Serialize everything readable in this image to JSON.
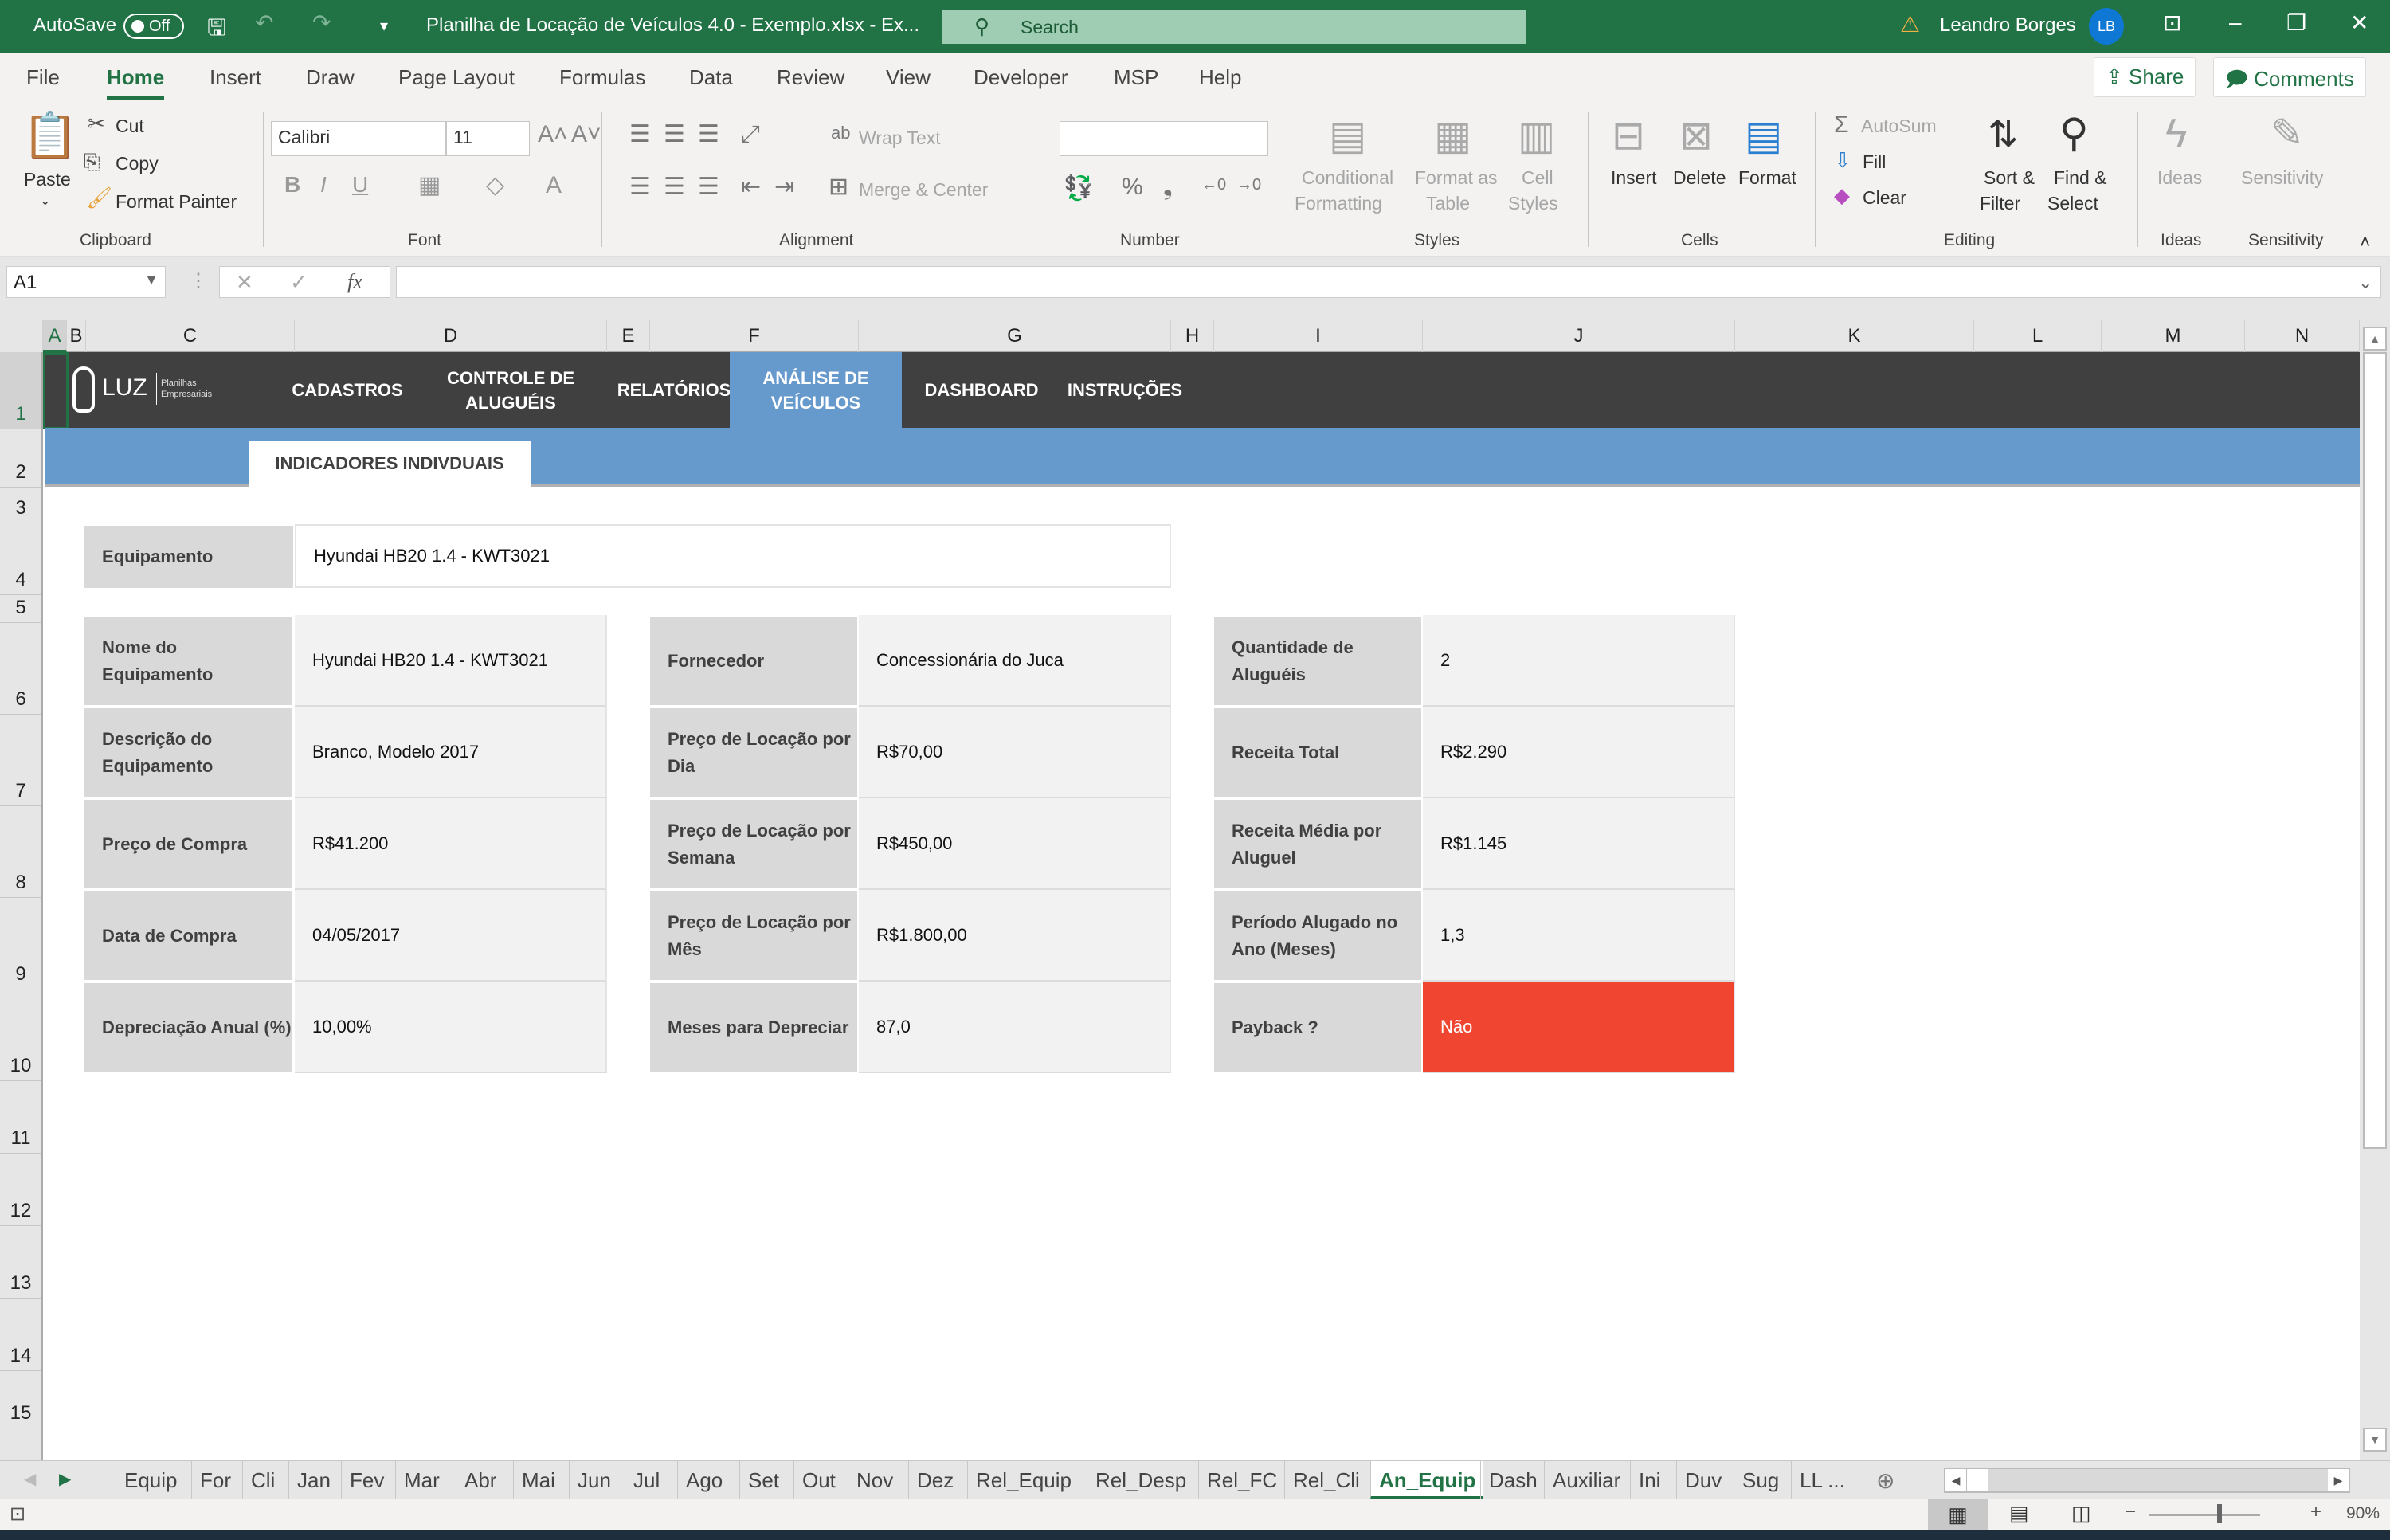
{
  "titlebar": {
    "autosave_label": "AutoSave",
    "autosave_state": "Off",
    "doc_title": "Planilha de Locação de Veículos 4.0 - Exemplo.xlsx  -  Ex...",
    "search_placeholder": "Search",
    "user_name": "Leandro Borges",
    "user_initials": "LB",
    "warning_icon": "warning-icon"
  },
  "ribbon_tabs": [
    "File",
    "Home",
    "Insert",
    "Draw",
    "Page Layout",
    "Formulas",
    "Data",
    "Review",
    "View",
    "Developer",
    "MSP",
    "Help"
  ],
  "active_tab": "Home",
  "share_label": "Share",
  "comments_label": "Comments",
  "ribbon": {
    "clipboard": {
      "paste": "Paste",
      "cut": "Cut",
      "copy": "Copy",
      "format_painter": "Format Painter",
      "group": "Clipboard"
    },
    "font": {
      "font_name": "Calibri",
      "font_size": "11",
      "group": "Font"
    },
    "alignment": {
      "wrap_text": "Wrap Text",
      "merge_center": "Merge & Center",
      "group": "Alignment"
    },
    "number": {
      "format": "",
      "group": "Number"
    },
    "styles": {
      "conditional": "Conditional",
      "conditional2": "Formatting",
      "format_as": "Format as",
      "format_as2": "Table",
      "cell": "Cell",
      "cell2": "Styles",
      "group": "Styles"
    },
    "cells": {
      "insert": "Insert",
      "delete": "Delete",
      "format": "Format",
      "group": "Cells"
    },
    "editing": {
      "autosum": "AutoSum",
      "fill": "Fill",
      "clear": "Clear",
      "sort": "Sort &",
      "sort2": "Filter",
      "find": "Find &",
      "find2": "Select",
      "group": "Editing"
    },
    "ideas": {
      "ideas": "Ideas",
      "group": "Ideas"
    },
    "sensitivity": {
      "sensitivity": "Sensitivity",
      "group": "Sensitivity"
    }
  },
  "formula_bar": {
    "name_box": "A1",
    "formula": ""
  },
  "columns": [
    "A",
    "B",
    "C",
    "D",
    "E",
    "F",
    "G",
    "H",
    "I",
    "J",
    "K",
    "L",
    "M",
    "N"
  ],
  "rows": [
    "1",
    "2",
    "3",
    "4",
    "5",
    "6",
    "7",
    "8",
    "9",
    "10",
    "11",
    "12",
    "13",
    "14",
    "15"
  ],
  "sheet": {
    "logo_text": "LUZ",
    "logo_sub1": "Planilhas",
    "logo_sub2": "Empresariais",
    "nav": [
      "CADASTROS",
      "CONTROLE DE ALUGUÉIS",
      "RELATÓRIOS",
      "ANÁLISE DE VEÍCULOS",
      "DASHBOARD",
      "INSTRUÇÕES"
    ],
    "nav_active": "ANÁLISE DE VEÍCULOS",
    "subtab": "INDICADORES INDIVDUAIS",
    "equip_label": "Equipamento",
    "equip_value": "Hyundai HB20 1.4 - KWT3021",
    "block1": [
      {
        "label": "Nome do Equipamento",
        "value": "Hyundai HB20 1.4 - KWT3021"
      },
      {
        "label": "Descrição do Equipamento",
        "value": "Branco, Modelo 2017"
      },
      {
        "label": "Preço de Compra",
        "value": "R$41.200"
      },
      {
        "label": "Data de Compra",
        "value": "04/05/2017"
      },
      {
        "label": "Depreciação Anual (%)",
        "value": "10,00%"
      }
    ],
    "block2": [
      {
        "label": "Fornecedor",
        "value": "Concessionária do Juca"
      },
      {
        "label": "Preço de Locação por Dia",
        "value": "R$70,00"
      },
      {
        "label": "Preço de Locação por Semana",
        "value": "R$450,00"
      },
      {
        "label": "Preço de Locação por Mês",
        "value": "R$1.800,00"
      },
      {
        "label": "Meses para Depreciar",
        "value": "87,0"
      }
    ],
    "block3": [
      {
        "label": "Quantidade de Aluguéis",
        "value": "2"
      },
      {
        "label": "Receita Total",
        "value": "R$2.290"
      },
      {
        "label": "Receita Média por Aluguel",
        "value": "R$1.145"
      },
      {
        "label": "Período Alugado no Ano (Meses)",
        "value": "1,3"
      },
      {
        "label": "Payback ?",
        "value": "Não"
      }
    ],
    "payback_color": "#f04530"
  },
  "sheet_tabs": [
    "Equip",
    "For",
    "Cli",
    "Jan",
    "Fev",
    "Mar",
    "Abr",
    "Mai",
    "Jun",
    "Jul",
    "Ago",
    "Set",
    "Out",
    "Nov",
    "Dez",
    "Rel_Equip",
    "Rel_Desp",
    "Rel_FC",
    "Rel_Cli",
    "An_Equip",
    "Dash",
    "Auxiliar",
    "Ini",
    "Duv",
    "Sug",
    "LL ..."
  ],
  "active_sheet": "An_Equip",
  "status": {
    "zoom": "90%"
  },
  "colors": {
    "excel_green": "#217346",
    "nav_dark": "#404040",
    "nav_blue": "#6699cc"
  }
}
